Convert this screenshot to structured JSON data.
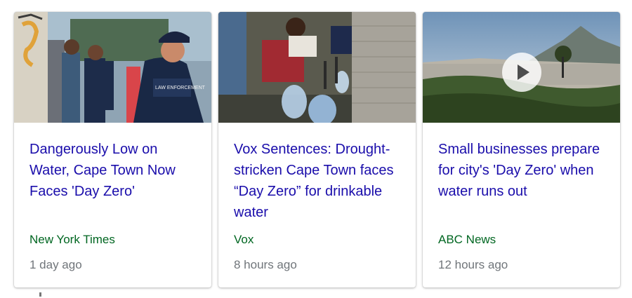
{
  "cards": [
    {
      "headline": "Dangerously Low on Water, Cape Town Now Faces 'Day Zero'",
      "source": "New York Times",
      "time": "1 day ago",
      "thumbnail_icon": "photo-police-officers-street"
    },
    {
      "headline": "Vox Sentences: Drought-stricken Cape Town faces “Day Zero” for drinkable water",
      "source": "Vox",
      "time": "8 hours ago",
      "thumbnail_icon": "photo-water-collection"
    },
    {
      "headline": "Small businesses prepare for city's 'Day Zero' when water runs out",
      "source": "ABC News",
      "time": "12 hours ago",
      "thumbnail_icon": "photo-city-mountain",
      "has_video": true
    }
  ],
  "colors": {
    "headline": "#1a0dab",
    "source": "#006621",
    "time": "#70757a"
  }
}
